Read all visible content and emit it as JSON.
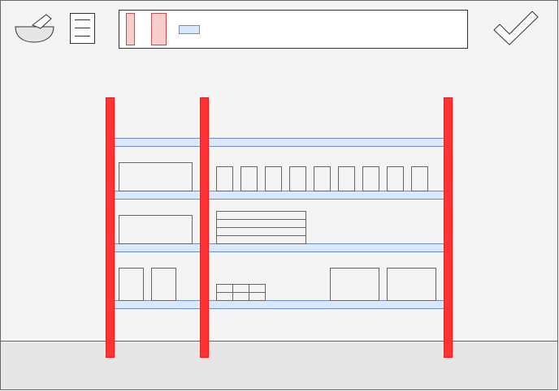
{
  "toolbar": {
    "icons": [
      "mortar-and-pestle-icon",
      "recipe-list-icon",
      "checkmark-icon"
    ],
    "palette": {
      "swatches": [
        "thin-red-upright",
        "wide-red-upright",
        "blue-shelf-plank"
      ]
    }
  },
  "shelving": {
    "unit_count": 1,
    "upright_count": 3,
    "shelf_levels": 4,
    "bays": [
      "left-bay",
      "right-bay"
    ],
    "items": {
      "level_1": [],
      "level_2": {
        "left_bay": [
          "wide-box"
        ],
        "right_bay": [
          "jar",
          "jar",
          "jar",
          "jar",
          "jar",
          "jar",
          "jar",
          "jar",
          "jar"
        ]
      },
      "level_3": {
        "left_bay": [
          "wide-box"
        ],
        "right_bay": [
          "stacked-trays"
        ]
      },
      "level_4": {
        "left_bay": [
          "tall-box",
          "tall-box"
        ],
        "right_bay": [
          "crate-grid",
          "large-box",
          "large-box"
        ]
      }
    }
  },
  "colors": {
    "background": "#f4f4f4",
    "floor": "#e6e6e6",
    "upright": "#ff3333",
    "upright_edge": "#e02020",
    "shelf": "#dae8fc",
    "shelf_edge": "#6c8ebf",
    "swatch_red": "#f8cecc",
    "swatch_red_edge": "#b85450",
    "outline": "#333333",
    "item_edge": "#666666"
  }
}
